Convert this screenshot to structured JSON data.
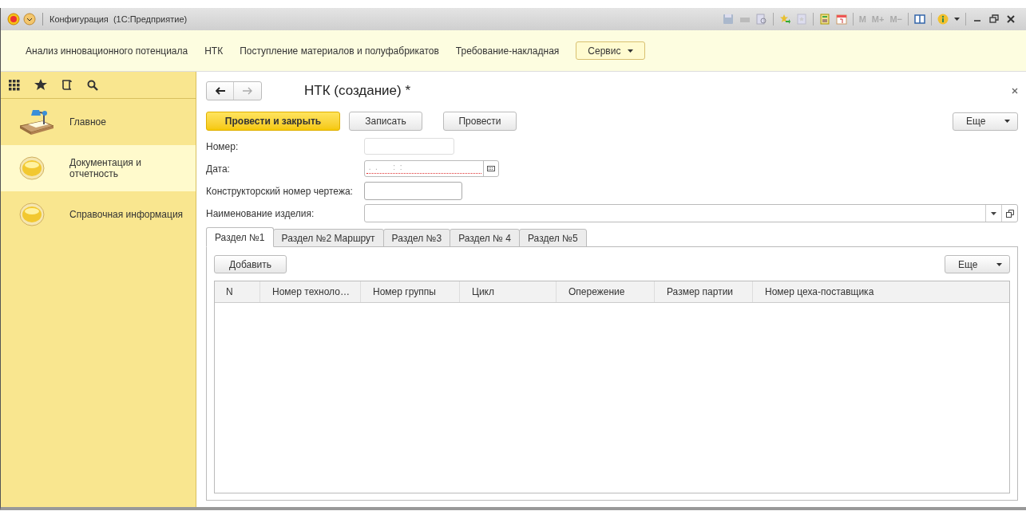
{
  "window": {
    "title": "Конфигурация  (1С:Предприятие)",
    "memory_buttons": [
      "M",
      "M+",
      "M−"
    ]
  },
  "sections": [
    {
      "label": "Анализ инновационного потенциала",
      "kind": "link"
    },
    {
      "label": "НТК",
      "kind": "link"
    },
    {
      "label": "Поступление материалов и полуфабрикатов",
      "kind": "link"
    },
    {
      "label": "Требование-накладная",
      "kind": "link"
    },
    {
      "label": "Сервис",
      "kind": "menu"
    }
  ],
  "sidebar": {
    "items": [
      {
        "label": "Главное",
        "kind": "lamp",
        "selected": false
      },
      {
        "label": "Документация и отчетность",
        "kind": "coin",
        "selected": true
      },
      {
        "label": "Справочная информация",
        "kind": "coin",
        "selected": false
      }
    ]
  },
  "form": {
    "title": "НТК (создание) *",
    "buttons": [
      {
        "label": "Провести и закрыть",
        "kind": "primary"
      },
      {
        "label": "Записать",
        "kind": "normal"
      },
      {
        "label": "Провести",
        "kind": "normal"
      }
    ],
    "more_button": "Еще",
    "fields": [
      {
        "label": "Номер:",
        "kind": "number"
      },
      {
        "label": "Дата:",
        "kind": "date",
        "mask": " .  .       :  :"
      },
      {
        "label": "Конструкторский номер чертежа:",
        "kind": "text"
      },
      {
        "label": "Наименование изделия:",
        "kind": "select"
      }
    ],
    "tabs": [
      {
        "label": "Раздел №1",
        "selected": true
      },
      {
        "label": "Раздел №2 Маршрут",
        "selected": false
      },
      {
        "label": "Раздел №3",
        "selected": false
      },
      {
        "label": "Раздел № 4",
        "selected": false
      },
      {
        "label": "Раздел №5",
        "selected": false
      }
    ],
    "add_button": "Добавить",
    "table_more_button": "Еще",
    "table": {
      "columns": [
        "N",
        "Номер техноло…",
        "Номер группы",
        "Цикл",
        "Опережение",
        "Размер партии",
        "Номер цеха-поставщика"
      ]
    }
  }
}
